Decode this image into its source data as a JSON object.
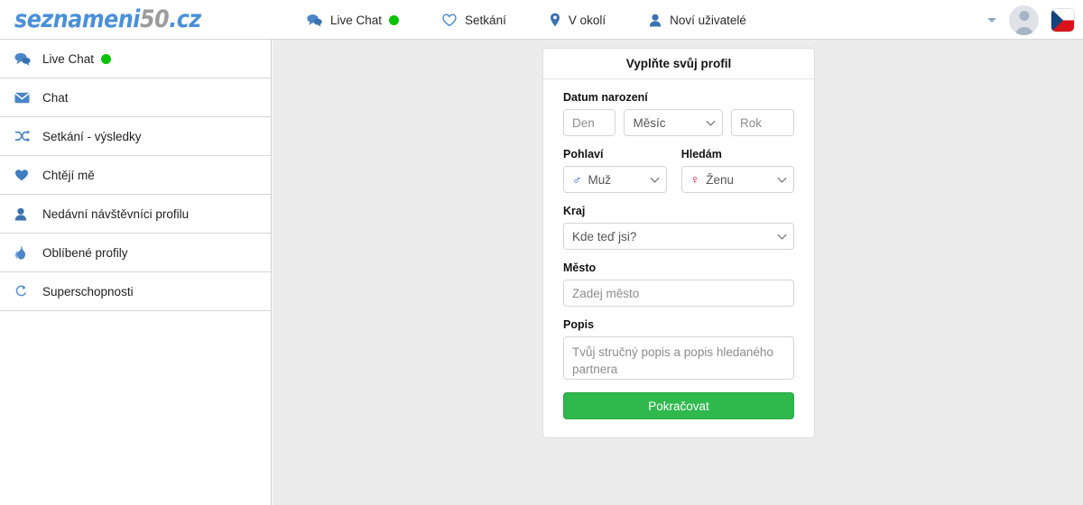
{
  "brand": {
    "part1": "seznameni",
    "part2": "50",
    "part3": ".cz",
    "color_blue": "#4a90d9",
    "color_gray": "#9c9c9c"
  },
  "topnav": {
    "items": [
      {
        "label": "Live Chat",
        "icon": "comments-icon",
        "has_status_dot": true
      },
      {
        "label": "Setkání",
        "icon": "heart-outline-icon",
        "has_status_dot": false
      },
      {
        "label": "V okolí",
        "icon": "map-pin-icon",
        "has_status_dot": false
      },
      {
        "label": "Noví uživatelé",
        "icon": "user-icon",
        "has_status_dot": false
      }
    ],
    "status_dot_color": "#06c206"
  },
  "topright": {
    "caret_icon": "chevron-down-icon",
    "avatar_icon": "avatar-placeholder",
    "flag_icon": "czech-flag-icon"
  },
  "sidebar": {
    "items": [
      {
        "label": "Live Chat",
        "icon": "comments-icon",
        "has_status_dot": true
      },
      {
        "label": "Chat",
        "icon": "envelope-icon",
        "has_status_dot": false
      },
      {
        "label": "Setkání - výsledky",
        "icon": "shuffle-icon",
        "has_status_dot": false
      },
      {
        "label": "Chtějí mě",
        "icon": "heart-filled-icon",
        "has_status_dot": false
      },
      {
        "label": "Nedávní návštěvníci profilu",
        "icon": "user-icon",
        "has_status_dot": false
      },
      {
        "label": "Oblíbené profily",
        "icon": "fire-icon",
        "has_status_dot": false
      },
      {
        "label": "Superschopnosti",
        "icon": "superpower-circle-icon",
        "has_status_dot": false
      }
    ]
  },
  "card": {
    "title": "Vyplňte svůj profil",
    "birth": {
      "label": "Datum narození",
      "day_placeholder": "Den",
      "month_value": "Měsíc",
      "year_placeholder": "Rok"
    },
    "gender": {
      "label": "Pohlaví",
      "value": "Muž",
      "symbol": "♂",
      "symbol_color": "#1a4fd6"
    },
    "seeking": {
      "label": "Hledám",
      "value": "Ženu",
      "symbol": "♀",
      "symbol_color": "#e4002b"
    },
    "region": {
      "label": "Kraj",
      "value": "Kde teď jsi?"
    },
    "city": {
      "label": "Město",
      "placeholder": "Zadej město"
    },
    "description": {
      "label": "Popis",
      "placeholder": "Tvůj stručný popis a popis hledaného partnera"
    },
    "submit": {
      "label": "Pokračovat",
      "color": "#2fb94d"
    }
  }
}
